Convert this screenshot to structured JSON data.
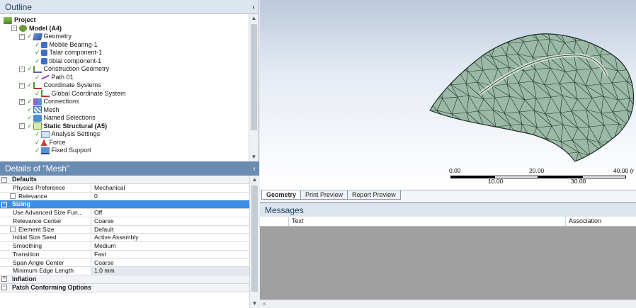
{
  "outline": {
    "title": "Outline",
    "pin": "ᵻ",
    "tree": [
      {
        "label": "Project",
        "icon": "project-icon",
        "bold": true,
        "depth": 0
      },
      {
        "label": "Model (A4)",
        "icon": "model-icon",
        "bold": true,
        "depth": 1,
        "expander": "-"
      },
      {
        "label": "Geometry",
        "icon": "geometry-icon",
        "bold": false,
        "depth": 2,
        "expander": "-"
      },
      {
        "label": "Mobile Bearing-1",
        "icon": "part-icon",
        "bold": false,
        "depth": 3
      },
      {
        "label": "Talar component-1",
        "icon": "part-icon",
        "bold": false,
        "depth": 3
      },
      {
        "label": "tibial component-1",
        "icon": "part-icon",
        "bold": false,
        "depth": 3
      },
      {
        "label": "Construction Geometry",
        "icon": "construction-geometry-icon",
        "bold": false,
        "depth": 2,
        "expander": "-"
      },
      {
        "label": "Path 01",
        "icon": "path-icon",
        "bold": false,
        "depth": 3
      },
      {
        "label": "Coordinate Systems",
        "icon": "coordinate-systems-icon",
        "bold": false,
        "depth": 2,
        "expander": "-"
      },
      {
        "label": "Global Coordinate System",
        "icon": "coordinate-system-icon",
        "bold": false,
        "depth": 3
      },
      {
        "label": "Connections",
        "icon": "connections-icon",
        "bold": false,
        "depth": 2,
        "expander": "+"
      },
      {
        "label": "Mesh",
        "icon": "mesh-icon",
        "bold": false,
        "depth": 2
      },
      {
        "label": "Named Selections",
        "icon": "named-selections-icon",
        "bold": false,
        "depth": 2
      },
      {
        "label": "Static Structural (A5)",
        "icon": "static-structural-icon",
        "bold": true,
        "depth": 2,
        "expander": "-"
      },
      {
        "label": "Analysis Settings",
        "icon": "analysis-settings-icon",
        "bold": false,
        "depth": 3
      },
      {
        "label": "Force",
        "icon": "force-icon",
        "bold": false,
        "depth": 3
      },
      {
        "label": "Fixed Support",
        "icon": "fixed-support-icon",
        "bold": false,
        "depth": 3
      }
    ]
  },
  "details": {
    "title": "Details of \"Mesh\"",
    "pin": "ᵻ",
    "sections": [
      {
        "title": "Defaults",
        "expander": "-",
        "selected": false,
        "rows": [
          {
            "key": "Physics Preference",
            "value": "Mechanical",
            "checkbox": false
          },
          {
            "key": "Relevance",
            "value": "0",
            "checkbox": true
          }
        ]
      },
      {
        "title": "Sizing",
        "expander": "-",
        "selected": true,
        "rows": [
          {
            "key": "Use Advanced Size Fun...",
            "value": "Off",
            "checkbox": false
          },
          {
            "key": "Relevance Center",
            "value": "Coarse",
            "checkbox": false
          },
          {
            "key": "Element Size",
            "value": "Default",
            "checkbox": true
          },
          {
            "key": "Initial Size Seed",
            "value": "Active Assembly",
            "checkbox": false
          },
          {
            "key": "Smoothing",
            "value": "Medium",
            "checkbox": false
          },
          {
            "key": "Transition",
            "value": "Fast",
            "checkbox": false
          },
          {
            "key": "Span Angle Center",
            "value": "Coarse",
            "checkbox": false
          },
          {
            "key": "Minimum Edge Length",
            "value": "1.0 mm",
            "checkbox": false,
            "shaded": true
          }
        ]
      },
      {
        "title": "Inflation",
        "expander": "+",
        "selected": false,
        "rows": []
      },
      {
        "title": "Patch Conforming Options",
        "expander": "-",
        "selected": false,
        "rows": []
      }
    ]
  },
  "viewport": {
    "ruler": {
      "top_labels": [
        "0.00",
        "20.00",
        "40.00 (r"
      ],
      "bottom_labels": [
        "10.00",
        "30.00"
      ]
    },
    "colors": {
      "mesh_fill": "#9ab9a6",
      "mesh_edge": "#1f2e25",
      "bg_top": "#bcc9dc"
    }
  },
  "tabs": [
    {
      "label": "Geometry",
      "active": true
    },
    {
      "label": "Print Preview",
      "active": false
    },
    {
      "label": "Report Preview",
      "active": false
    }
  ],
  "messages": {
    "title": "Messages",
    "columns": [
      "",
      "Text",
      "Association"
    ],
    "scroll_left": "<"
  }
}
